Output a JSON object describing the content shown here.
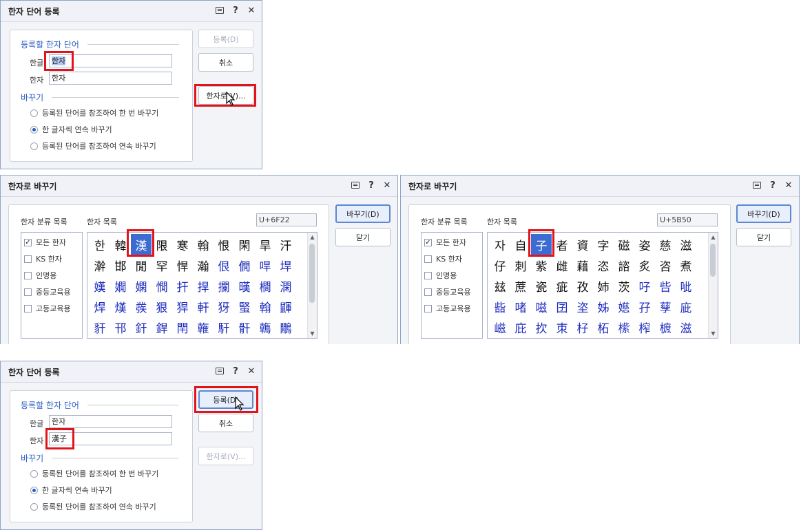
{
  "register_dialog_1": {
    "title": "한자 단어 등록",
    "section_word": "등록할 한자 단어",
    "hangul_label": "한글",
    "hangul_value": "한자",
    "hanja_label": "한자",
    "hanja_value": "한자",
    "section_replace": "바꾸기",
    "options": [
      "등록된 단어를 참조하여 한 번 바꾸기",
      "한 글자씩 연속 바꾸기",
      "등록된 단어를 참조하여 연속 바꾸기"
    ],
    "selected_option": 1,
    "btn_register": "등록(D)",
    "btn_cancel": "취소",
    "btn_hanja": "한자로(V)..."
  },
  "convert_dialog_1": {
    "title": "한자로 바꾸기",
    "category_title": "한자 분류 목록",
    "list_title": "한자 목록",
    "code": "U+6F22",
    "categories": [
      {
        "label": "모든 한자",
        "checked": true
      },
      {
        "label": "KS 한자",
        "checked": false
      },
      {
        "label": "인명용",
        "checked": false
      },
      {
        "label": "중등교육용",
        "checked": false
      },
      {
        "label": "고등교육용",
        "checked": false
      }
    ],
    "chars": [
      "한",
      "韓",
      "漢",
      "限",
      "寒",
      "翰",
      "恨",
      "閑",
      "旱",
      "汗",
      "澣",
      "邯",
      "閒",
      "罕",
      "悍",
      "瀚",
      "佷",
      "僩",
      "哻",
      "垾",
      "嫨",
      "嫺",
      "嫻",
      "憪",
      "扞",
      "捍",
      "攔",
      "暵",
      "橺",
      "澖",
      "焊",
      "熯",
      "彂",
      "狠",
      "猂",
      "軒",
      "犽",
      "蜸",
      "翰",
      "鼲",
      "豻",
      "邗",
      "釬",
      "銲",
      "閈",
      "雗",
      "馯",
      "骭",
      "鶾",
      "鷳"
    ],
    "black_count": 16,
    "selected_index": 2,
    "btn_convert": "바꾸기(D)",
    "btn_close": "닫기"
  },
  "convert_dialog_2": {
    "title": "한자로 바꾸기",
    "category_title": "한자 분류 목록",
    "list_title": "한자 목록",
    "code": "U+5B50",
    "categories": [
      {
        "label": "모든 한자",
        "checked": true
      },
      {
        "label": "KS 한자",
        "checked": false
      },
      {
        "label": "인명용",
        "checked": false
      },
      {
        "label": "중등교육용",
        "checked": false
      },
      {
        "label": "고등교육용",
        "checked": false
      }
    ],
    "chars": [
      "자",
      "自",
      "子",
      "者",
      "資",
      "字",
      "磁",
      "姿",
      "慈",
      "滋",
      "仔",
      "刺",
      "紫",
      "雌",
      "藉",
      "恣",
      "諮",
      "炙",
      "咨",
      "煮",
      "玆",
      "蔗",
      "瓷",
      "疵",
      "孜",
      "姉",
      "茨",
      "吇",
      "呰",
      "呲",
      "啙",
      "啫",
      "嗞",
      "囝",
      "垐",
      "姊",
      "嬨",
      "孖",
      "孶",
      "庛",
      "嵫",
      "庇",
      "扻",
      "朿",
      "杍",
      "柘",
      "橴",
      "榨",
      "樜",
      "滋"
    ],
    "black_count": 27,
    "selected_index": 2,
    "btn_convert": "바꾸기(D)",
    "btn_close": "닫기"
  },
  "register_dialog_2": {
    "title": "한자 단어 등록",
    "section_word": "등록할 한자 단어",
    "hangul_label": "한글",
    "hangul_value": "한자",
    "hanja_label": "한자",
    "hanja_value": "漢子",
    "section_replace": "바꾸기",
    "options": [
      "등록된 단어를 참조하여 한 번 바꾸기",
      "한 글자씩 연속 바꾸기",
      "등록된 단어를 참조하여 연속 바꾸기"
    ],
    "selected_option": 1,
    "btn_register": "등록(D)",
    "btn_cancel": "취소",
    "btn_hanja": "한자로(V)..."
  },
  "icons": [
    "comment-icon",
    "help-icon",
    "close-icon",
    "mouse-pointer-icon",
    "checkmark-icon",
    "scroll-up-icon",
    "scroll-down-icon"
  ],
  "colors": {
    "highlight": "#e2141b",
    "accent": "#2f5ec4",
    "selection": "#3c6bd2",
    "blue_char": "#1c2bbf"
  }
}
